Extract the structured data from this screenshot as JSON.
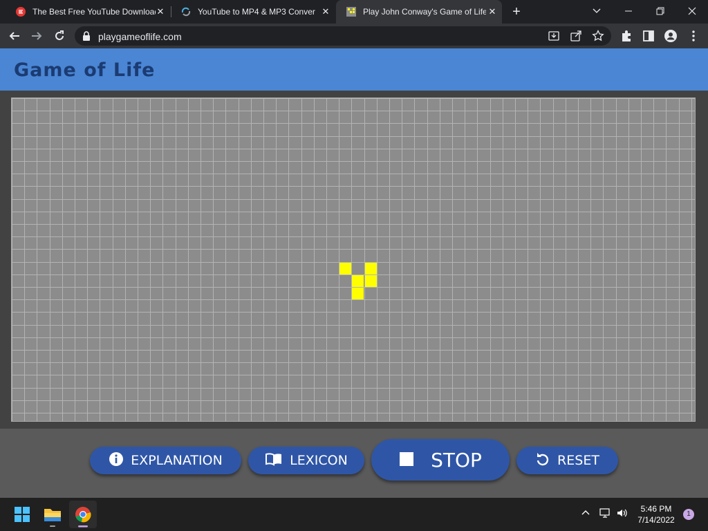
{
  "browser": {
    "tabs": [
      {
        "title": "The Best Free YouTube Downloader",
        "favicon": "red-brand-icon"
      },
      {
        "title": "YouTube to MP4 & MP3 Converter",
        "favicon": "converter-icon"
      },
      {
        "title": "Play John Conway's Game of Life",
        "favicon": "game-of-life-icon",
        "active": true
      }
    ],
    "new_tab_label": "+",
    "url": "playgameoflife.com",
    "window_controls": [
      "chevron-down-icon",
      "minimize-icon",
      "restore-icon",
      "close-icon"
    ]
  },
  "page": {
    "title": "Game of Life",
    "colors": {
      "header": "#4a86d4",
      "board": "#8c8c8c",
      "live_cell": "#ffff00",
      "button": "#2f56a6"
    },
    "board": {
      "live_cells": [
        [
          26,
          13
        ],
        [
          28,
          13
        ],
        [
          27,
          14
        ],
        [
          28,
          14
        ],
        [
          27,
          15
        ]
      ]
    },
    "buttons": {
      "explanation": "EXPLANATION",
      "lexicon": "LEXICON",
      "stop": "STOP",
      "reset": "RESET"
    }
  },
  "taskbar": {
    "time": "5:46 PM",
    "date": "7/14/2022",
    "notification_count": "1"
  }
}
